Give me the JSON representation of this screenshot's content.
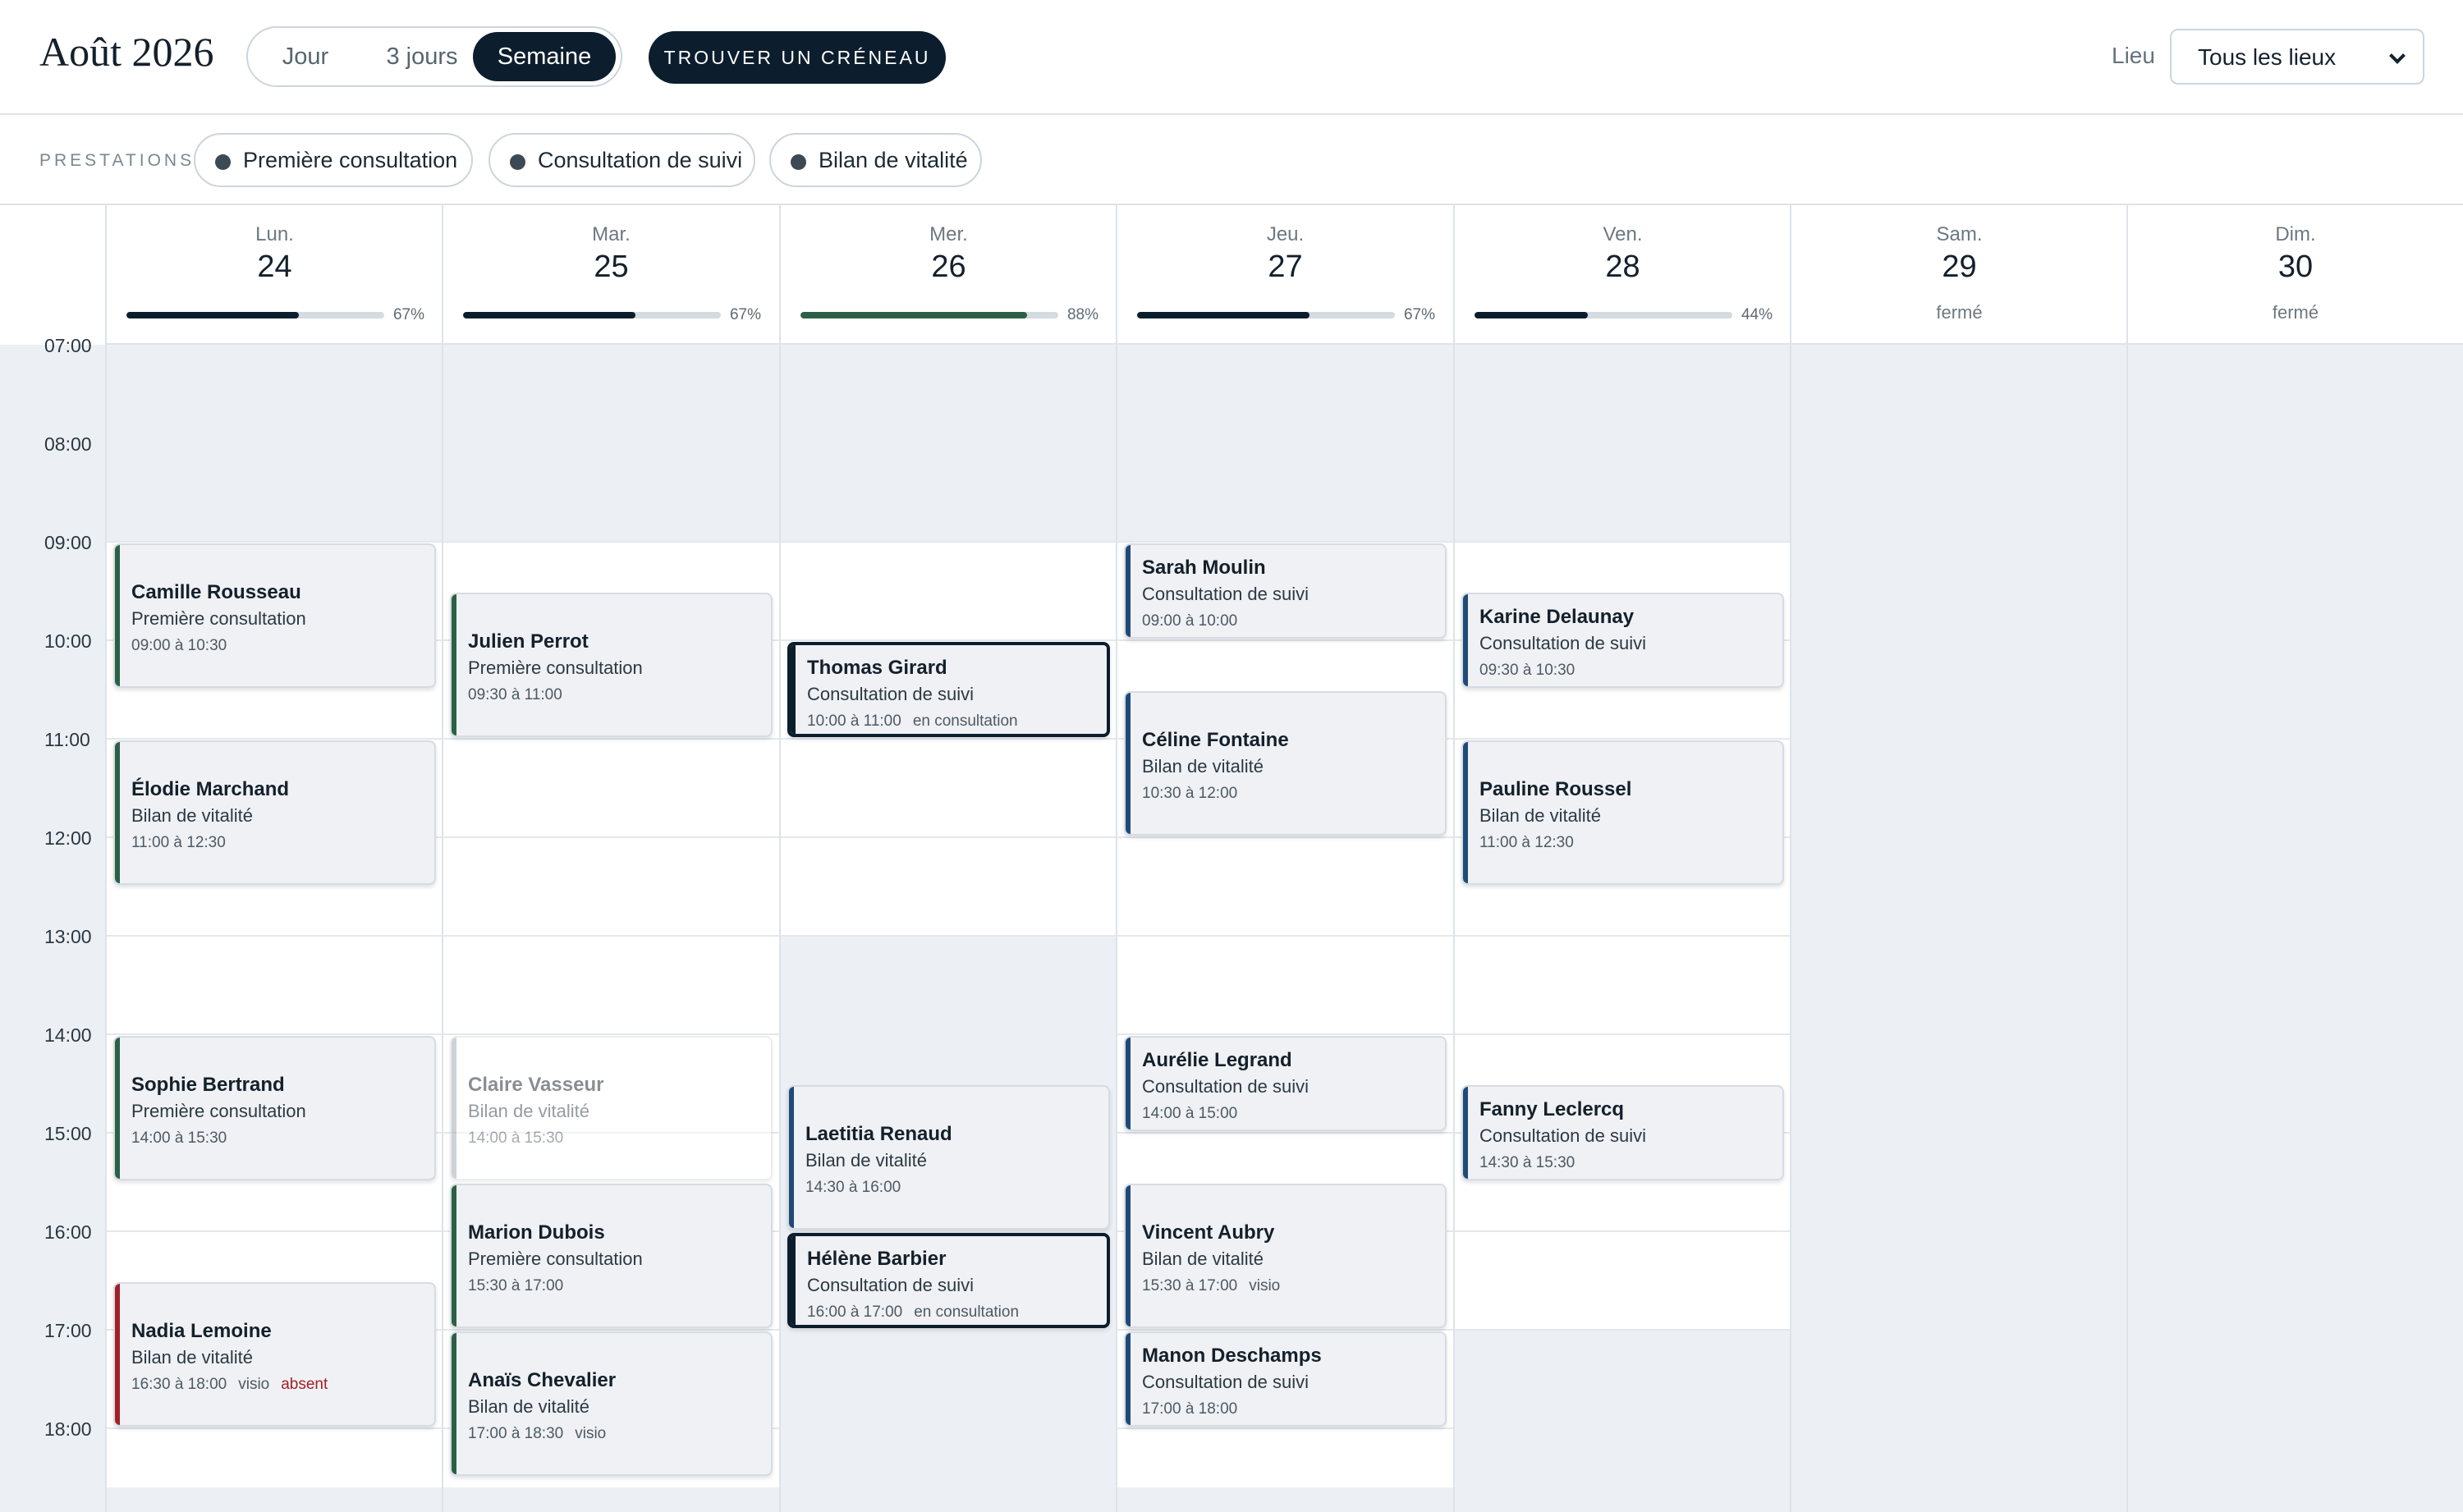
{
  "header": {
    "month": "Août 2026",
    "views": [
      "Jour",
      "3 jours",
      "Semaine"
    ],
    "active_view": "Semaine",
    "find_slot_label": "TROUVER UN CRÉNEAU",
    "location_label": "Lieu",
    "location_value": "Tous les lieux"
  },
  "filters": {
    "label": "PRESTATIONS",
    "chips": [
      "Première consultation",
      "Consultation de suivi",
      "Bilan de vitalité"
    ]
  },
  "times": [
    "07:00",
    "08:00",
    "09:00",
    "10:00",
    "11:00",
    "12:00",
    "13:00",
    "14:00",
    "15:00",
    "16:00",
    "17:00",
    "18:00"
  ],
  "colors": {
    "first_consultation": "#2b6046",
    "follow_up": "#1f4a78",
    "absent": "#a21f28",
    "cancelled": "#9ea6ad",
    "capacity_default": "#0c1e2e",
    "capacity_high": "#2b6046"
  },
  "days": [
    {
      "name": "Lun.",
      "num": "24",
      "capacity": "67%",
      "fill": 0.67
    },
    {
      "name": "Mar.",
      "num": "25",
      "capacity": "67%",
      "fill": 0.67
    },
    {
      "name": "Mer.",
      "num": "26",
      "capacity": "88%",
      "fill": 0.88
    },
    {
      "name": "Jeu.",
      "num": "27",
      "capacity": "67%",
      "fill": 0.67
    },
    {
      "name": "Ven.",
      "num": "28",
      "capacity": "44%",
      "fill": 0.44
    },
    {
      "name": "Sam.",
      "num": "29",
      "status": "fermé"
    },
    {
      "name": "Dim.",
      "num": "30",
      "status": "fermé"
    }
  ],
  "appointments": [
    {
      "day": 0,
      "name": "Camille Rousseau",
      "type": "Première consultation",
      "time": "09:00 à 10:30"
    },
    {
      "day": 0,
      "name": "Élodie Marchand",
      "type": "Bilan de vitalité",
      "time": "11:00 à 12:30"
    },
    {
      "day": 0,
      "name": "Sophie Bertrand",
      "type": "Première consultation",
      "time": "14:00 à 15:30"
    },
    {
      "day": 0,
      "name": "Nadia Lemoine",
      "type": "Bilan de vitalité",
      "time": "16:30 à 18:00",
      "tags": [
        "visio",
        "absent"
      ]
    },
    {
      "day": 1,
      "name": "Julien Perrot",
      "type": "Première consultation",
      "time": "09:30 à 11:00"
    },
    {
      "day": 1,
      "name": "Claire Vasseur",
      "type": "Bilan de vitalité",
      "time": "14:00 à 15:30"
    },
    {
      "day": 1,
      "name": "Marion Dubois",
      "type": "Première consultation",
      "time": "15:30 à 17:00"
    },
    {
      "day": 1,
      "name": "Anaïs Chevalier",
      "type": "Bilan de vitalité",
      "time": "17:00 à 18:30",
      "tags": [
        "visio"
      ]
    },
    {
      "day": 2,
      "name": "Thomas Girard",
      "type": "Consultation de suivi",
      "time": "10:00 à 11:00",
      "tags": [
        "en consultation"
      ]
    },
    {
      "day": 2,
      "name": "Laetitia Renaud",
      "type": "Bilan de vitalité",
      "time": "14:30 à 16:00"
    },
    {
      "day": 2,
      "name": "Hélène Barbier",
      "type": "Consultation de suivi",
      "time": "16:00 à 17:00",
      "tags": [
        "en consultation"
      ]
    },
    {
      "day": 3,
      "name": "Sarah Moulin",
      "type": "Consultation de suivi",
      "time": "09:00 à 10:00"
    },
    {
      "day": 3,
      "name": "Céline Fontaine",
      "type": "Bilan de vitalité",
      "time": "10:30 à 12:00"
    },
    {
      "day": 3,
      "name": "Aurélie Legrand",
      "type": "Consultation de suivi",
      "time": "14:00 à 15:00"
    },
    {
      "day": 3,
      "name": "Vincent Aubry",
      "type": "Bilan de vitalité",
      "time": "15:30 à 17:00",
      "tags": [
        "visio"
      ]
    },
    {
      "day": 3,
      "name": "Manon Deschamps",
      "type": "Consultation de suivi",
      "time": "17:00 à 18:00"
    },
    {
      "day": 4,
      "name": "Karine Delaunay",
      "type": "Consultation de suivi",
      "time": "09:30 à 10:30"
    },
    {
      "day": 4,
      "name": "Pauline Roussel",
      "type": "Bilan de vitalité",
      "time": "11:00 à 12:30"
    },
    {
      "day": 4,
      "name": "Fanny Leclercq",
      "type": "Consultation de suivi",
      "time": "14:30 à 15:30"
    }
  ]
}
